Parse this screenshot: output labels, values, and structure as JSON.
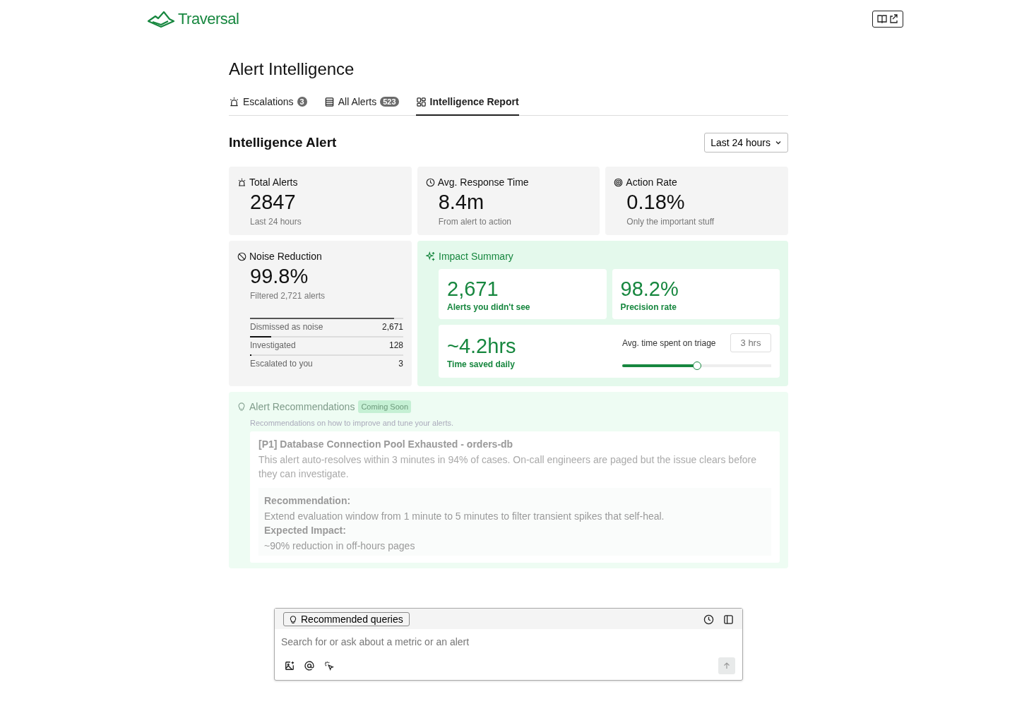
{
  "header": {
    "logo": "Traversal"
  },
  "page_title": "Alert Intelligence",
  "tabs": [
    {
      "label": "Escalations",
      "badge": "3",
      "selected": false
    },
    {
      "label": "All Alerts",
      "badge": "523",
      "selected": false
    },
    {
      "label": "Intelligence Report",
      "selected": true
    }
  ],
  "section": {
    "title": "Intelligence Alert",
    "range": "Last 24 hours"
  },
  "stats": [
    {
      "label": "Total Alerts",
      "value": "2847",
      "caption": "Last 24 hours"
    },
    {
      "label": "Avg. Response Time",
      "value": "8.4m",
      "caption": "From alert to action"
    },
    {
      "label": "Action Rate",
      "value": "0.18%",
      "caption": "Only the important stuff"
    }
  ],
  "noise": {
    "label": "Noise Reduction",
    "value": "99.8%",
    "caption": "Filtered 2,721 alerts",
    "rows": [
      {
        "label": "Dismissed as noise",
        "count": "2,671",
        "level": 0.94
      },
      {
        "label": "Investigated",
        "count": "128",
        "level": 0.14
      },
      {
        "label": "Escalated to you",
        "count": "3",
        "level": 0.01
      }
    ]
  },
  "impact": {
    "title": "Impact Summary",
    "tiles": [
      {
        "value": "2,671",
        "caption": "Alerts you didn't see"
      },
      {
        "value": "98.2%",
        "caption": "Precision rate"
      }
    ],
    "time_saved": {
      "value": "~4.2hrs",
      "caption": "Time saved daily"
    },
    "triage": {
      "label": "Avg. time spent on triage",
      "placeholder": "3 hrs",
      "level": 0.5
    }
  },
  "recommendations": {
    "title": "Alert Recommendations",
    "badge": "Coming Soon",
    "subtitle": "Recommendations on how to improve and tune your alerts.",
    "card": {
      "title": "[P1] Database Connection Pool Exhausted - orders-db",
      "body": "This alert auto-resolves within 3 minutes in 94% of cases. On-call engineers are paged but the issue clears before they can investigate.",
      "recommendation_label": "Recommendation:",
      "recommendation": "Extend evaluation window from 1 minute to 5 minutes to filter transient spikes that self-heal.",
      "impact_label": "Expected Impact:",
      "impact": "~90% reduction in off-hours pages"
    }
  },
  "query_box": {
    "chip": "Recommended queries",
    "placeholder": "Search for or ask about a metric or an alert"
  }
}
